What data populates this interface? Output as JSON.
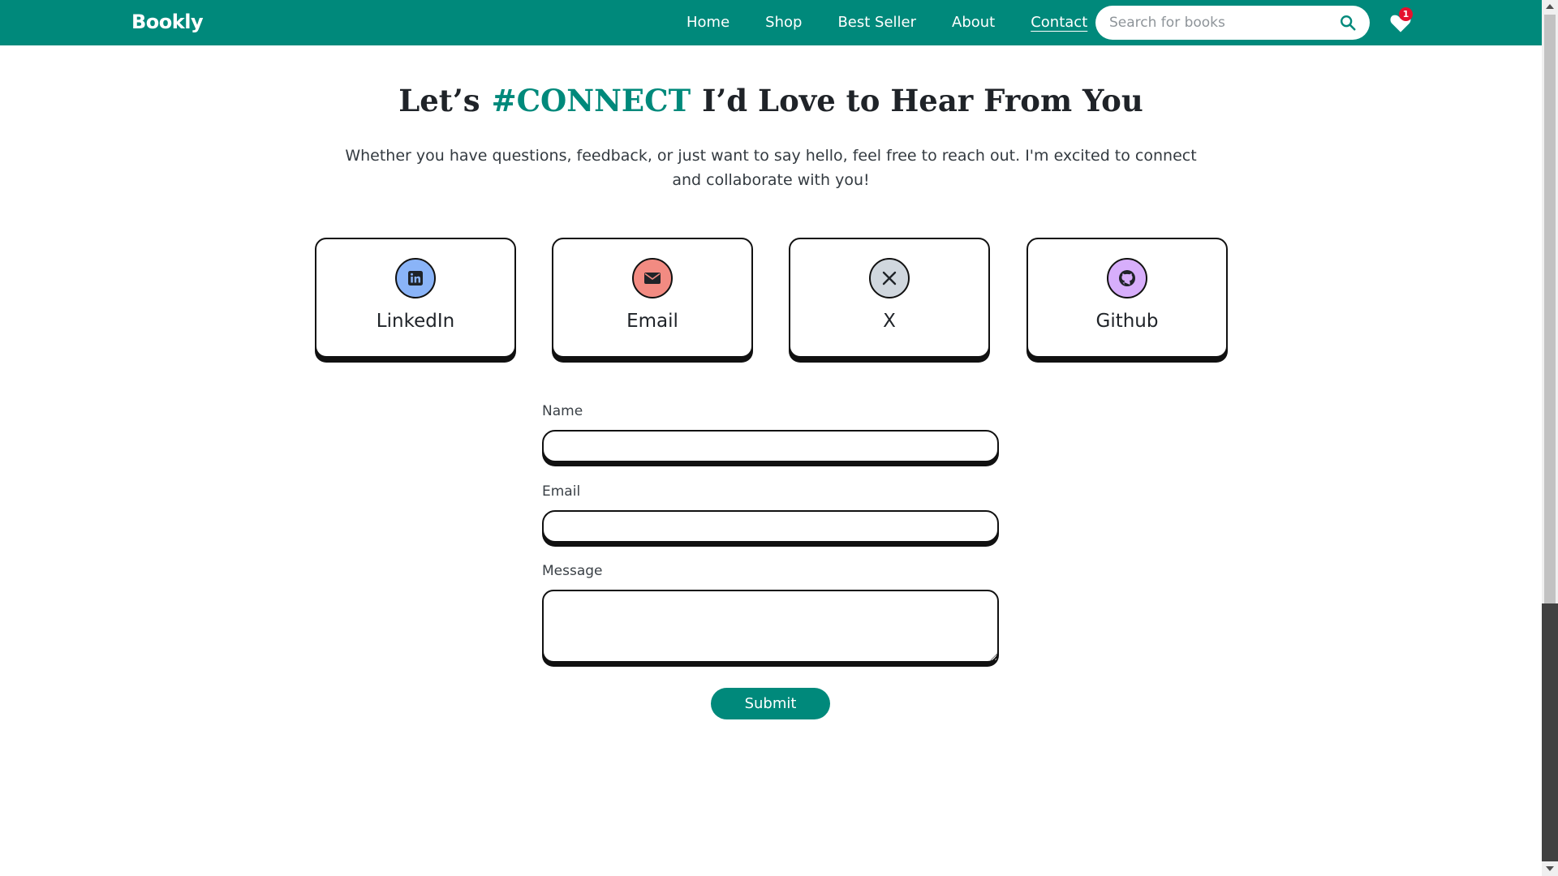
{
  "nav": {
    "brand": "Bookly",
    "links": [
      "Home",
      "Shop",
      "Best Seller",
      "About",
      "Contact"
    ],
    "active_link": "Contact",
    "search_placeholder": "Search for books",
    "search_icon": "search-icon",
    "favorites_icon": "heart-icon",
    "favorites_count": "1"
  },
  "hero": {
    "title_prefix": "Let’s",
    "title_accent": "#CONNECT",
    "title_suffix": "I’d Love to Hear From You",
    "subtitle": "Whether you have questions, feedback, or just want to say hello, feel free to reach out. I'm excited to connect and collaborate with you!"
  },
  "socials": [
    {
      "label": "LinkedIn",
      "icon": "linkedin-icon",
      "color": "#8ab4f8"
    },
    {
      "label": "Email",
      "icon": "envelope-icon",
      "color": "#f28b82"
    },
    {
      "label": "X",
      "icon": "x-icon",
      "color": "#d0d7de"
    },
    {
      "label": "Github",
      "icon": "github-icon",
      "color": "#d7aefb"
    }
  ],
  "form": {
    "name_label": "Name",
    "name_value": "",
    "email_label": "Email",
    "email_value": "",
    "message_label": "Message",
    "message_value": "",
    "submit_label": "Submit"
  },
  "colors": {
    "brand": "#00897b",
    "badge": "#e5112d",
    "border": "#111111"
  }
}
